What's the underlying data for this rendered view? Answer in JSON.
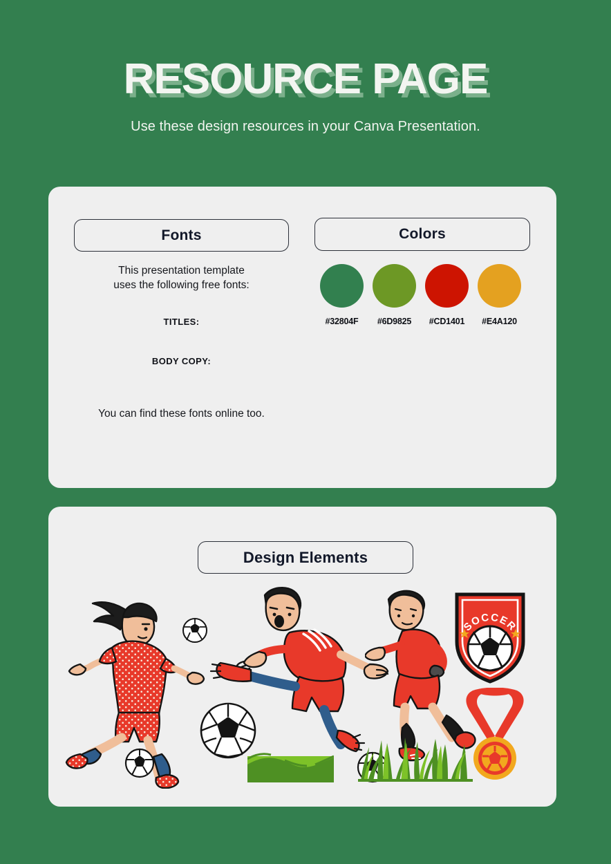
{
  "header": {
    "title": "RESOURCE PAGE",
    "subtitle": "Use these design resources in your Canva Presentation."
  },
  "cards": {
    "resources": {
      "fonts": {
        "heading": "Fonts",
        "intro": "This presentation template\nuses the following free fonts:",
        "titles_label": "TITLES:",
        "titles_value": "",
        "body_label": "BODY COPY:",
        "body_value": "",
        "outro": "You can find these fonts online too."
      },
      "colors": {
        "heading": "Colors",
        "swatches": [
          {
            "hex": "#32804F",
            "label": "#32804F"
          },
          {
            "hex": "#6D9825",
            "label": "#6D9825"
          },
          {
            "hex": "#CD1401",
            "label": "#CD1401"
          },
          {
            "hex": "#E4A120",
            "label": "#E4A120"
          }
        ]
      }
    },
    "elements": {
      "heading": "Design Elements",
      "items": [
        {
          "name": "female-soccer-player-kicking-illustration"
        },
        {
          "name": "small-soccer-ball"
        },
        {
          "name": "large-soccer-ball"
        },
        {
          "name": "tiny-soccer-ball"
        },
        {
          "name": "male-soccer-player-kicking-illustration"
        },
        {
          "name": "male-soccer-player-standing-illustration"
        },
        {
          "name": "medium-soccer-ball"
        },
        {
          "name": "soccer-shield-badge"
        },
        {
          "name": "soccer-medal"
        },
        {
          "name": "grass-field-patch"
        },
        {
          "name": "tall-grass-blades"
        }
      ],
      "badge_text": "SOCCER"
    }
  },
  "theme": {
    "background": "#337F4F",
    "card_background": "#EFEFEF",
    "text_dark": "#121829",
    "text_light": "#F3F5F1",
    "jersey_red": "#E8392A",
    "jersey_red_dark": "#C8281B",
    "skin": "#F0BE9A",
    "sock_blue": "#2F5D8C",
    "sock_black": "#1A1A1A",
    "hair_black": "#1C1C1C",
    "grass_light": "#7DC228",
    "grass_dark": "#4E9023",
    "badge_red": "#E8392A",
    "medal_gold": "#F2A81E",
    "outline": "#111111"
  }
}
